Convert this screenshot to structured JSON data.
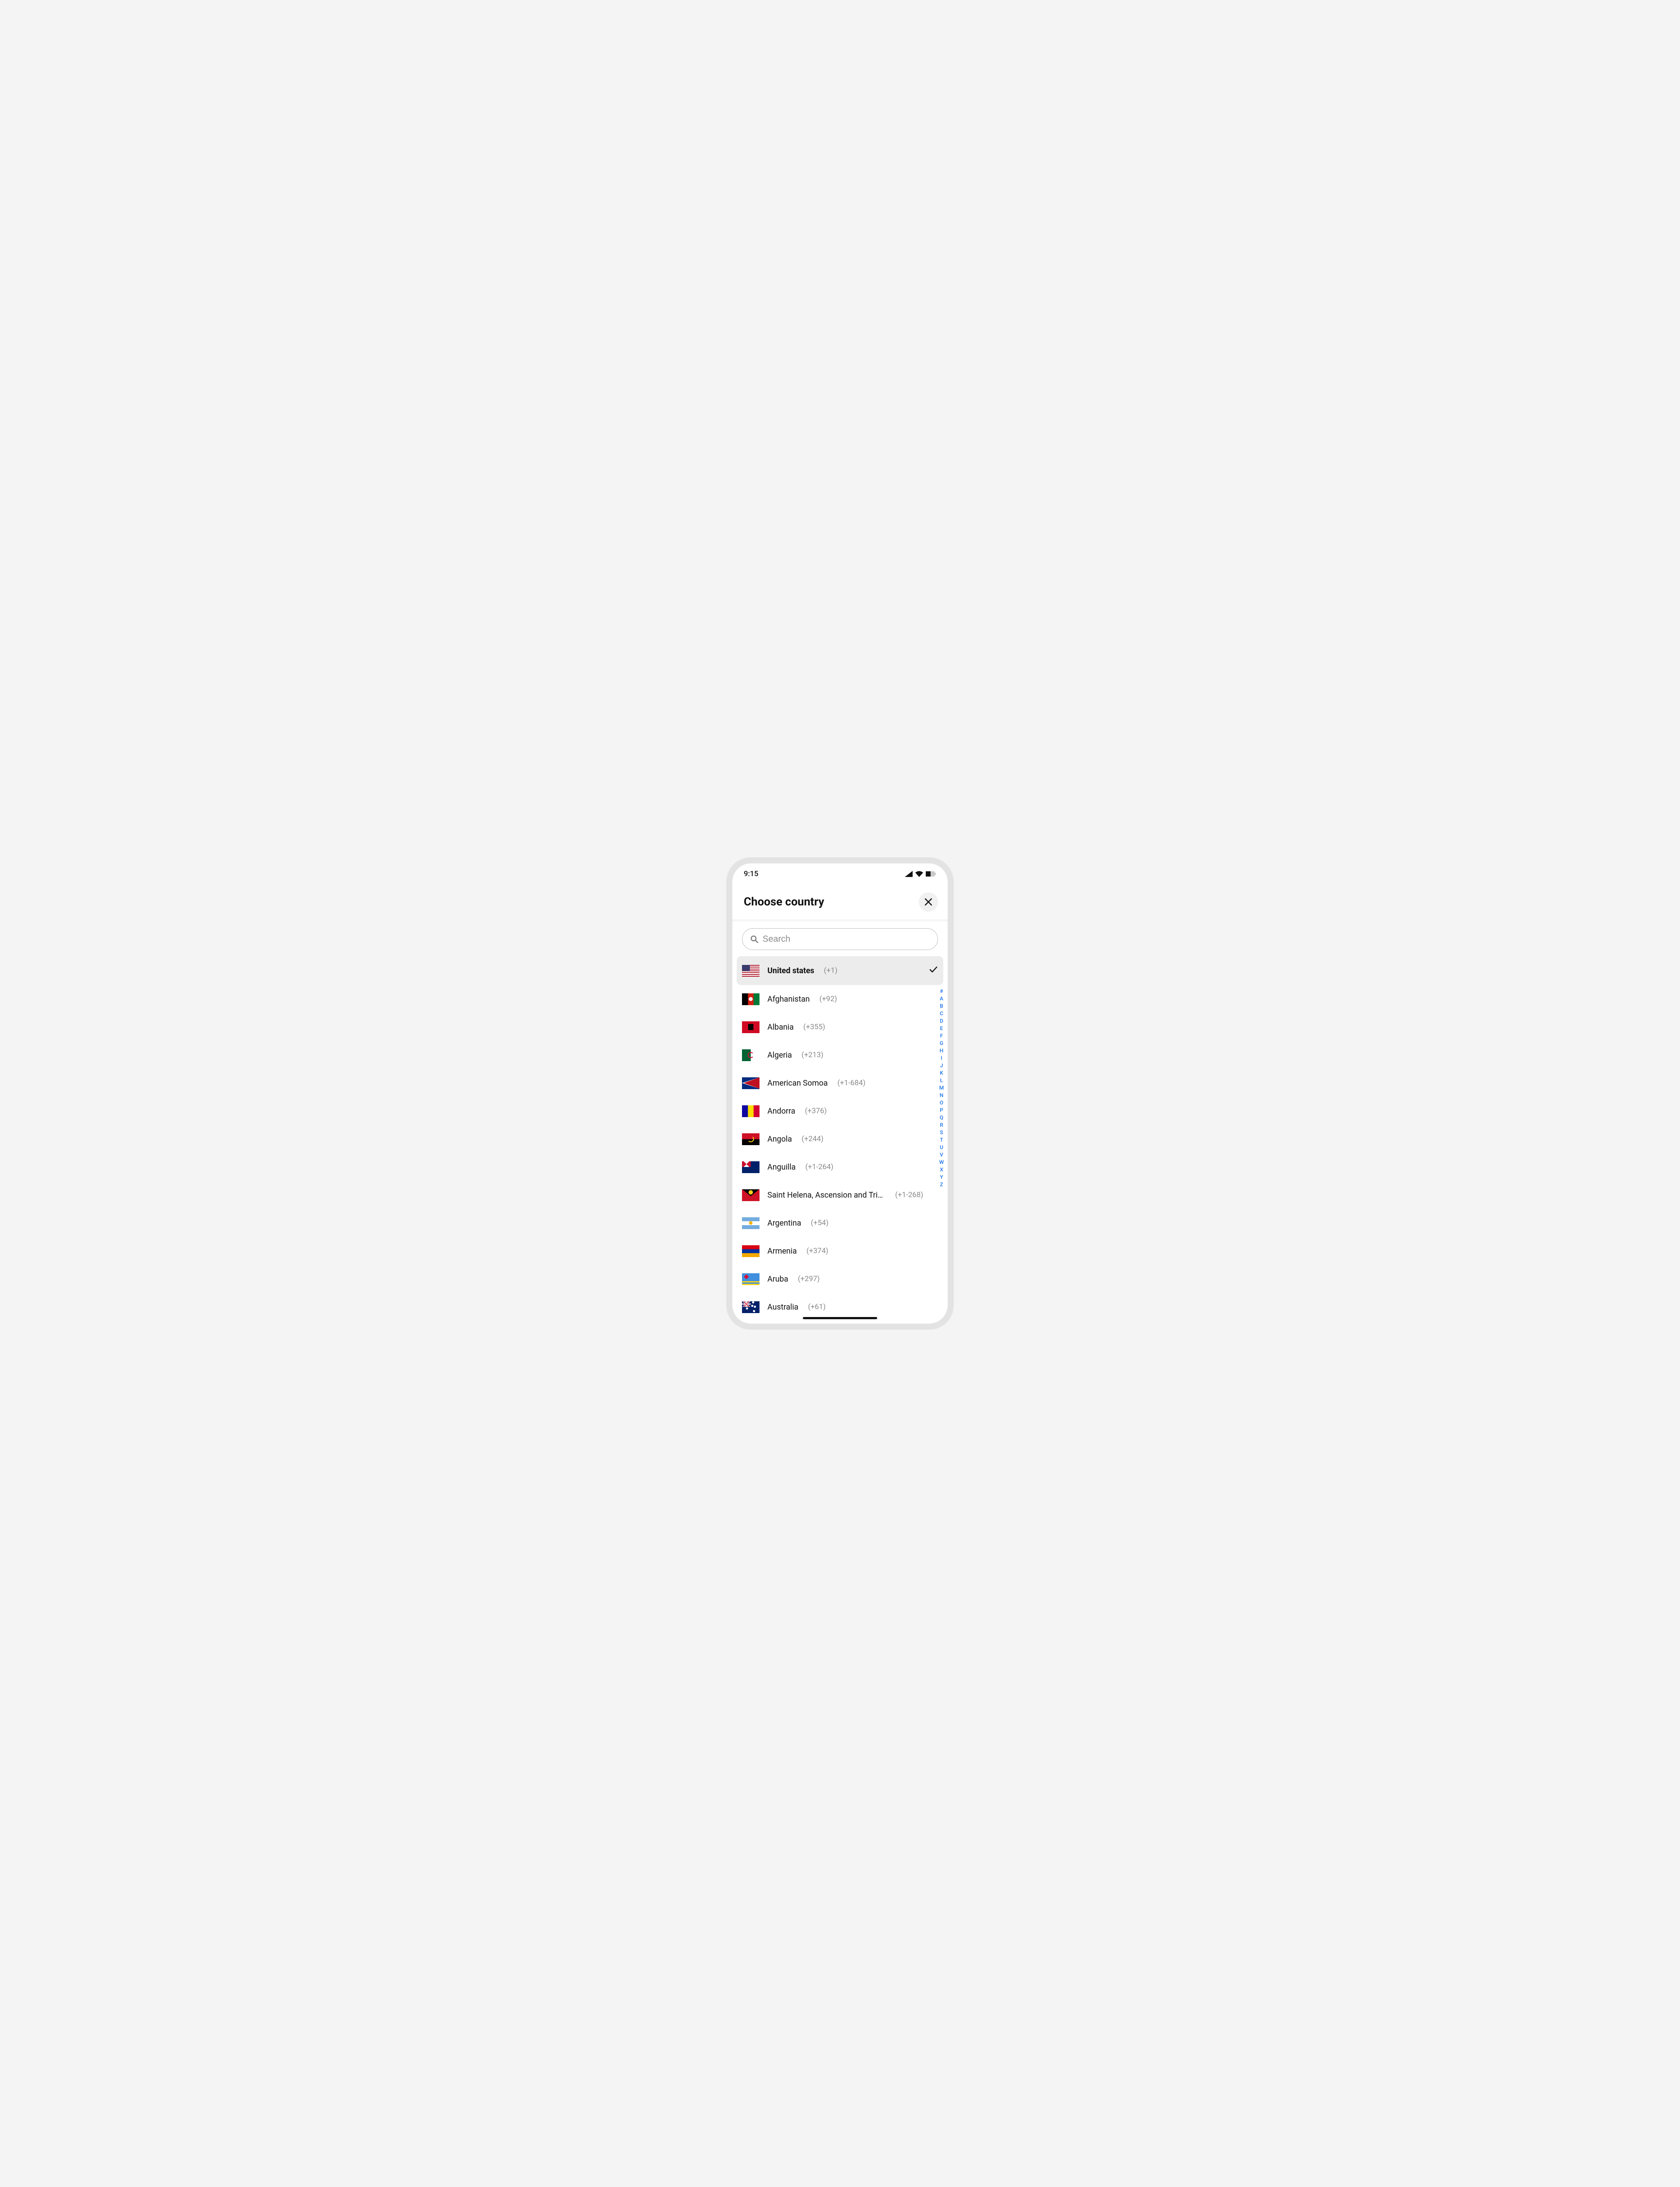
{
  "statusbar": {
    "time": "9:15"
  },
  "header": {
    "title": "Choose country"
  },
  "search": {
    "placeholder": "Search"
  },
  "selected": {
    "name": "United states",
    "code": "(+1)",
    "flag": "us"
  },
  "countries": [
    {
      "name": "Afghanistan",
      "code": "(+92)",
      "flag": "af"
    },
    {
      "name": "Albania",
      "code": "(+355)",
      "flag": "al"
    },
    {
      "name": "Algeria",
      "code": "(+213)",
      "flag": "dz"
    },
    {
      "name": "American Somoa",
      "code": "(+1-684)",
      "flag": "as"
    },
    {
      "name": "Andorra",
      "code": "(+376)",
      "flag": "ad"
    },
    {
      "name": "Angola",
      "code": "(+244)",
      "flag": "ao"
    },
    {
      "name": "Anguilla",
      "code": "(+1-264)",
      "flag": "ai"
    },
    {
      "name": "Saint Helena, Ascension and Tris...",
      "code": "(+1-268)",
      "flag": "ag"
    },
    {
      "name": "Argentina",
      "code": "(+54)",
      "flag": "ar"
    },
    {
      "name": "Armenia",
      "code": "(+374)",
      "flag": "am"
    },
    {
      "name": "Aruba",
      "code": "(+297)",
      "flag": "aw"
    },
    {
      "name": "Australia",
      "code": "(+61)",
      "flag": "au"
    }
  ],
  "alpha_index": [
    "#",
    "A",
    "B",
    "C",
    "D",
    "E",
    "F",
    "G",
    "H",
    "I",
    "J",
    "K",
    "L",
    "M",
    "N",
    "O",
    "P",
    "Q",
    "R",
    "S",
    "T",
    "U",
    "V",
    "W",
    "X",
    "Y",
    "Z"
  ]
}
